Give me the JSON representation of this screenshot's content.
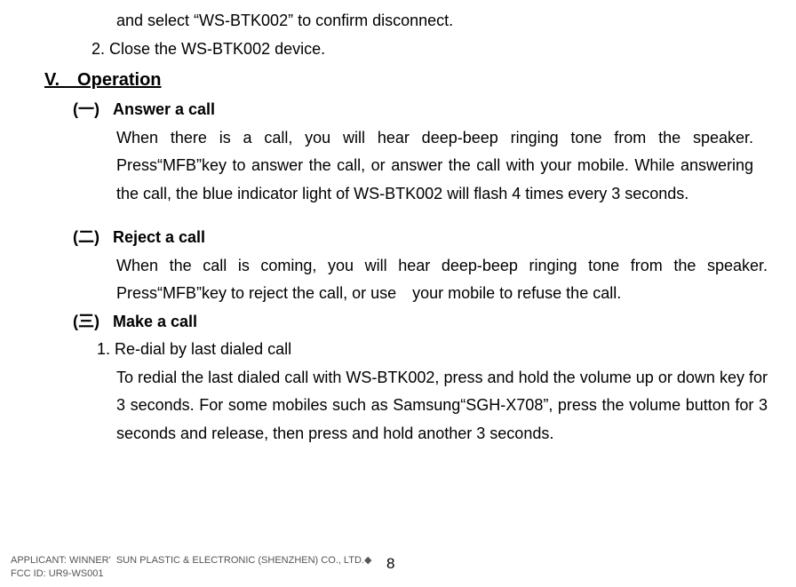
{
  "intro": {
    "line1": "and select “WS-BTK002” to confirm disconnect.",
    "line2": "2. Close the WS-BTK002 device."
  },
  "section": {
    "label": "V. Operation"
  },
  "sub1": {
    "num": "(一)",
    "title": "Answer a call",
    "body": "When there is a call, you will hear deep-beep ringing tone from the speaker. Press“MFB”key to answer the call, or answer the call with your mobile. While answering the call, the blue indicator light of WS-BTK002 will flash 4 times every 3 seconds."
  },
  "sub2": {
    "num": "(二)",
    "title": "Reject a call",
    "body": "When the call is coming, you will hear deep-beep ringing tone from the speaker. Press“MFB”key to reject the call, or use your mobile to refuse the call."
  },
  "sub3": {
    "num": "(三)",
    "title": "Make a call",
    "item1_label": "1. Re-dial by last dialed call",
    "item1_body": "To redial the last dialed call with WS-BTK002, press and hold the volume up or down key for 3 seconds. For some mobiles such as Samsung“SGH-X708”, press the volume button for 3 seconds and release, then press and hold another 3 seconds."
  },
  "footer": {
    "line1": "APPLICANT: WINNER'  SUN PLASTIC & ELECTRONIC (SHENZHEN) CO., LTD.◆",
    "line2": "FCC ID: UR9-WS001"
  },
  "page_number": "8"
}
